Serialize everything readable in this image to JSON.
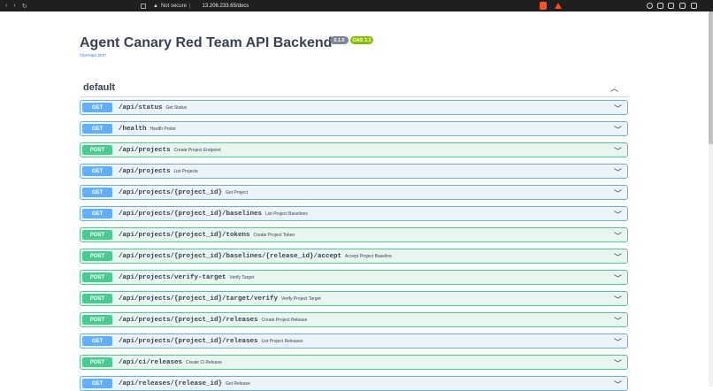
{
  "browser": {
    "security_label": "Not secure",
    "url": "13.206.233.65/docs"
  },
  "page": {
    "title": "Agent Canary Red Team API Backend",
    "version_badge": "0.1.0",
    "oas_badge": "OAS 3.1",
    "openapi_link": "/openapi.json",
    "section_label": "default"
  },
  "operations": [
    {
      "method": "GET",
      "path": "/api/status",
      "summary": "Get Status"
    },
    {
      "method": "GET",
      "path": "/health",
      "summary": "Health Probe"
    },
    {
      "method": "POST",
      "path": "/api/projects",
      "summary": "Create Project Endpoint"
    },
    {
      "method": "GET",
      "path": "/api/projects",
      "summary": "List Projects"
    },
    {
      "method": "GET",
      "path": "/api/projects/{project_id}",
      "summary": "Get Project"
    },
    {
      "method": "GET",
      "path": "/api/projects/{project_id}/baselines",
      "summary": "List Project Baselines"
    },
    {
      "method": "POST",
      "path": "/api/projects/{project_id}/tokens",
      "summary": "Create Project Token"
    },
    {
      "method": "POST",
      "path": "/api/projects/{project_id}/baselines/{release_id}/accept",
      "summary": "Accept Project Baseline"
    },
    {
      "method": "POST",
      "path": "/api/projects/verify-target",
      "summary": "Verify Target"
    },
    {
      "method": "POST",
      "path": "/api/projects/{project_id}/target/verify",
      "summary": "Verify Project Target"
    },
    {
      "method": "POST",
      "path": "/api/projects/{project_id}/releases",
      "summary": "Create Project Release"
    },
    {
      "method": "GET",
      "path": "/api/projects/{project_id}/releases",
      "summary": "List Project Releases"
    },
    {
      "method": "POST",
      "path": "/api/ci/releases",
      "summary": "Create Ci Release"
    },
    {
      "method": "GET",
      "path": "/api/releases/{release_id}",
      "summary": "Get Release"
    }
  ],
  "icons": {
    "chevron": "chevron-down-icon",
    "collapse": "chevron-up-icon"
  },
  "colors": {
    "get": "#61affe",
    "post": "#49cc90",
    "badge_oas": "#89bf04"
  }
}
